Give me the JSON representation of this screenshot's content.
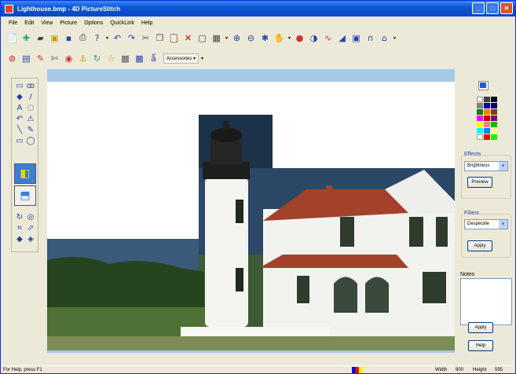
{
  "window": {
    "title": "Lighthouse.bmp - 4D PictureStitch",
    "controls": [
      "_",
      "□",
      "✕"
    ]
  },
  "menu": [
    "File",
    "Edit",
    "View",
    "Picture",
    "Options",
    "QuickLink",
    "Help"
  ],
  "toolbar1_icons": [
    "new-icon",
    "open-icon",
    "scan-icon",
    "camera-icon",
    "save-icon",
    "print-icon",
    "help-pointer-icon",
    "undo-icon",
    "redo-icon",
    "cut-icon",
    "copy-icon",
    "paste-icon",
    "delete-icon",
    "crop-icon",
    "grid-icon",
    "zoom-in-icon",
    "zoom-out-icon",
    "zoom-fit-icon",
    "hand-icon",
    "color-icon",
    "contrast-icon",
    "waveform-icon",
    "levels-icon",
    "frame-icon",
    "arch-icon",
    "shape-icon"
  ],
  "toolbar2_icons": [
    "redeye-icon",
    "image-icon",
    "paint-icon",
    "scissors-icon",
    "globe-icon",
    "anchor-icon",
    "rotate-icon",
    "star-icon",
    "cube-icon",
    "mosaic-icon",
    "text-icon"
  ],
  "accessories_label": "Accessories",
  "right_panel": {
    "swatches": [
      "#ffffff",
      "#404040",
      "#000000",
      "#808080",
      "#0000a0",
      "#000080",
      "#008000",
      "#ff8000",
      "#804000",
      "#ff00ff",
      "#c00000",
      "#800080",
      "#ffff00",
      "#ff8080",
      "#00c000",
      "#00ffff",
      "#0080ff",
      "#ffff80",
      "#ffffff",
      "#ff0000",
      "#00ff00"
    ],
    "effects_label": "Effects",
    "effects_value": "Brightness",
    "preview_label": "Preview",
    "filters_label": "Filters",
    "filters_value": "Despeckle",
    "apply_label": "Apply",
    "notes_label": "Notes",
    "notes_apply_label": "Apply",
    "help_label": "Help"
  },
  "status": {
    "hint": "For Help, press F1",
    "width_label": "Width",
    "width_value": "900",
    "height_label": "Height",
    "height_value": "595"
  }
}
